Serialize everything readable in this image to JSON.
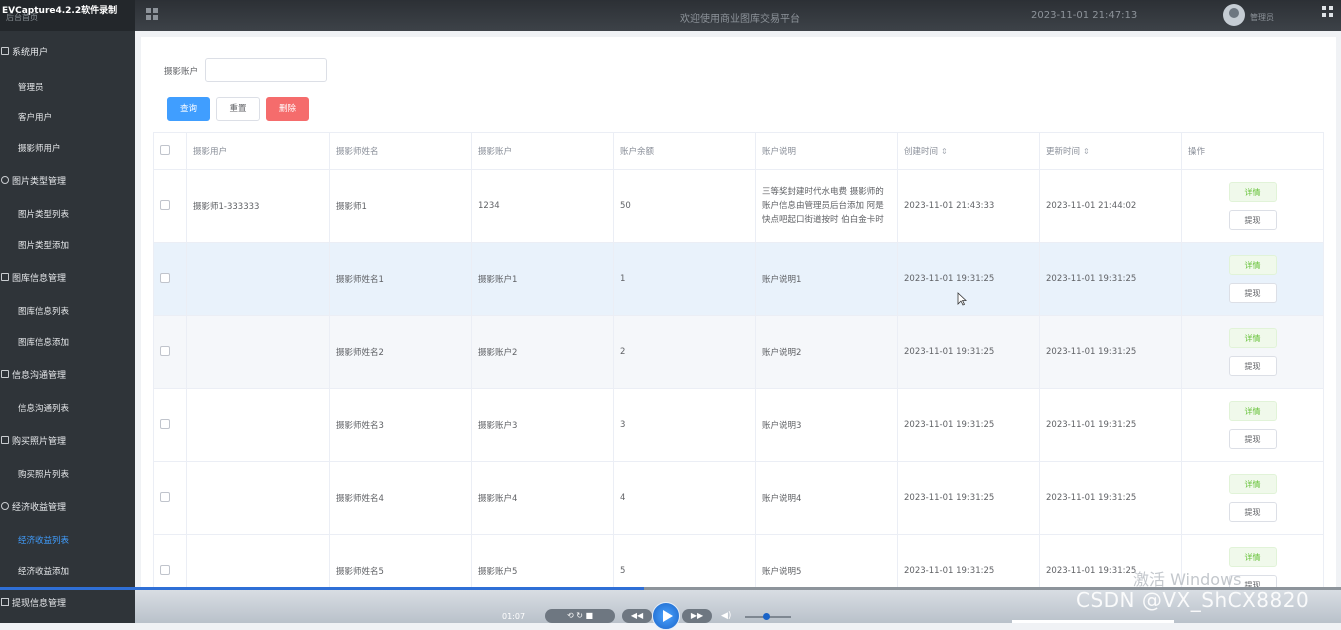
{
  "topbar": {
    "recorder": "EVCapture4.2.2软件录制",
    "brand_sub": "后台首页",
    "title": "欢迎使用商业图库交易平台",
    "datetime": "2023-11-01 21:47:13",
    "username": "管理员"
  },
  "sidebar": {
    "groups": [
      {
        "label": "系统用户",
        "items": [
          "管理员",
          "客户用户",
          "摄影师用户"
        ]
      },
      {
        "label": "图片类型管理",
        "items": [
          "图片类型列表",
          "图片类型添加"
        ]
      },
      {
        "label": "图库信息管理",
        "items": [
          "图库信息列表",
          "图库信息添加"
        ]
      },
      {
        "label": "信息沟通管理",
        "items": [
          "信息沟通列表"
        ]
      },
      {
        "label": "购买照片管理",
        "items": [
          "购买照片列表"
        ]
      },
      {
        "label": "经济收益管理",
        "items": [
          "经济收益列表",
          "经济收益添加"
        ]
      },
      {
        "label": "提现信息管理",
        "items": []
      }
    ],
    "active_item": "经济收益列表"
  },
  "search": {
    "label": "摄影账户",
    "value": "",
    "query_btn": "查询",
    "reset_btn": "重置",
    "delete_btn": "删除"
  },
  "table": {
    "headers": [
      "摄影用户",
      "摄影师姓名",
      "摄影账户",
      "账户余额",
      "账户说明",
      "创建时间",
      "更新时间",
      "操作"
    ],
    "sort_icon": "⇕",
    "rows": [
      {
        "user": "摄影师1-333333",
        "name": "摄影师1",
        "account": "1234",
        "balance": "50",
        "desc": "三等奖封建时代水电费 摄影师的账户信息由管理员后台添加 阿是快点吧起口街道按时 伯白金卡时",
        "created": "2023-11-01 21:43:33",
        "updated": "2023-11-01 21:44:02"
      },
      {
        "user": "",
        "name": "摄影师姓名1",
        "account": "摄影账户1",
        "balance": "1",
        "desc": "账户说明1",
        "created": "2023-11-01 19:31:25",
        "updated": "2023-11-01 19:31:25"
      },
      {
        "user": "",
        "name": "摄影师姓名2",
        "account": "摄影账户2",
        "balance": "2",
        "desc": "账户说明2",
        "created": "2023-11-01 19:31:25",
        "updated": "2023-11-01 19:31:25"
      },
      {
        "user": "",
        "name": "摄影师姓名3",
        "account": "摄影账户3",
        "balance": "3",
        "desc": "账户说明3",
        "created": "2023-11-01 19:31:25",
        "updated": "2023-11-01 19:31:25"
      },
      {
        "user": "",
        "name": "摄影师姓名4",
        "account": "摄影账户4",
        "balance": "4",
        "desc": "账户说明4",
        "created": "2023-11-01 19:31:25",
        "updated": "2023-11-01 19:31:25"
      },
      {
        "user": "",
        "name": "摄影师姓名5",
        "account": "摄影账户5",
        "balance": "5",
        "desc": "账户说明5",
        "created": "2023-11-01 19:31:25",
        "updated": "2023-11-01 19:31:25"
      }
    ],
    "detail_btn": "详情",
    "withdraw_btn": "提现"
  },
  "player": {
    "elapsed": "01:07",
    "progress": 0.48,
    "volume": 0.45
  },
  "watermarks": {
    "windows": "激活 Windows",
    "csdn": "CSDN @VX_ShCX8820"
  },
  "colors": {
    "accent": "#409eff",
    "danger": "#f56c6c",
    "success": "#67c23a",
    "sidebar_bg": "#2f3439"
  }
}
